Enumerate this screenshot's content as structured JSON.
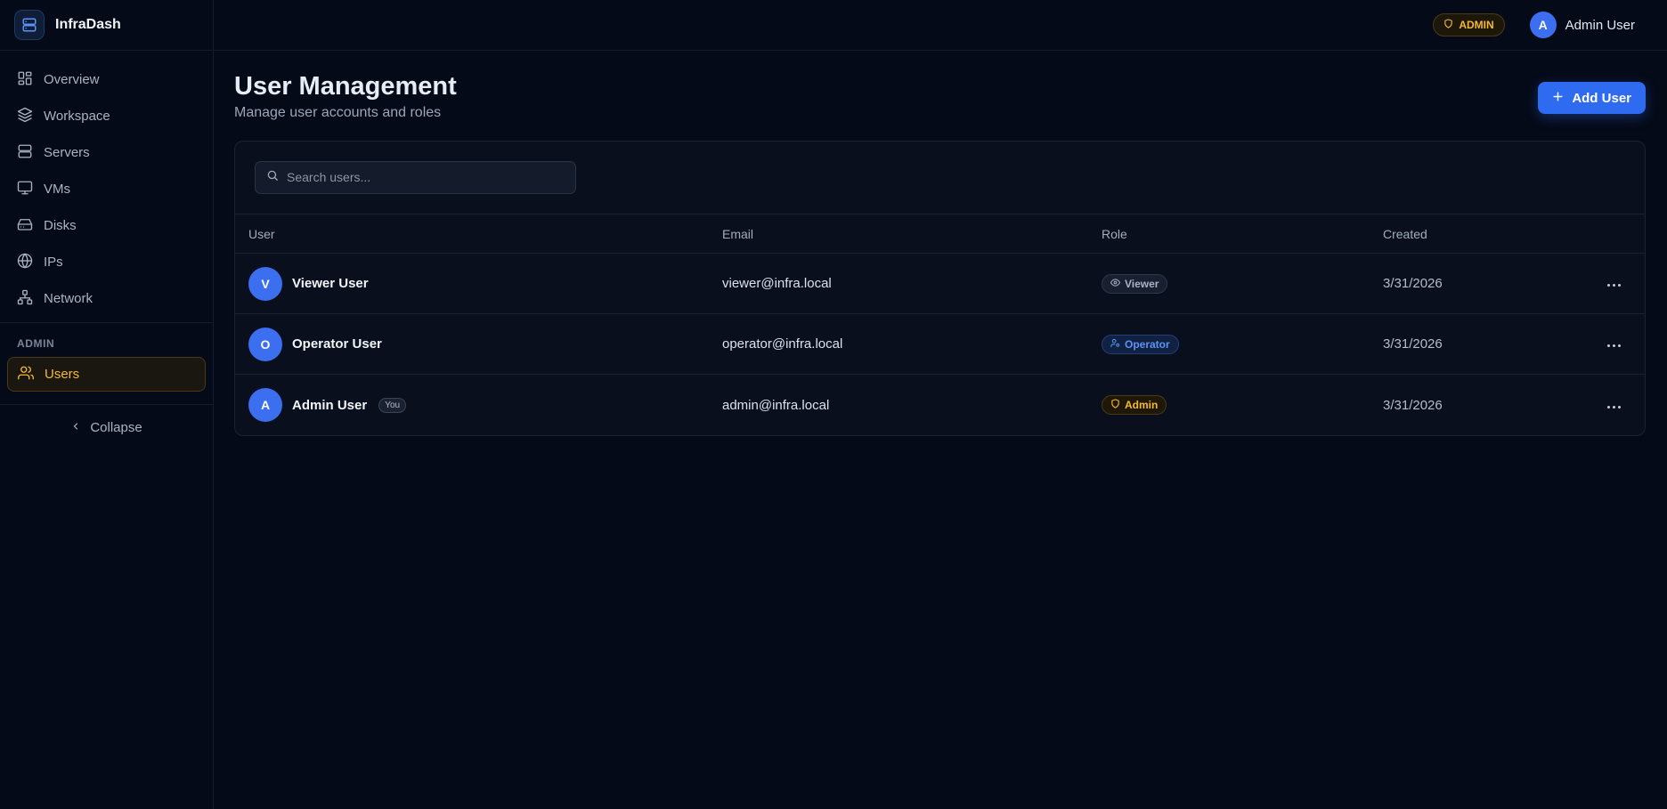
{
  "brand": {
    "name": "InfraDash"
  },
  "sidebar": {
    "items": [
      {
        "label": "Overview",
        "icon": "layout-dashboard-icon"
      },
      {
        "label": "Workspace",
        "icon": "layers-icon"
      },
      {
        "label": "Servers",
        "icon": "server-icon"
      },
      {
        "label": "VMs",
        "icon": "monitor-icon"
      },
      {
        "label": "Disks",
        "icon": "hard-drive-icon"
      },
      {
        "label": "IPs",
        "icon": "globe-icon"
      },
      {
        "label": "Network",
        "icon": "network-icon"
      }
    ],
    "admin_section_label": "ADMIN",
    "admin_items": [
      {
        "label": "Users",
        "icon": "users-icon",
        "active": true
      }
    ],
    "collapse_label": "Collapse"
  },
  "topbar": {
    "role_pill": "ADMIN",
    "user_initial": "A",
    "user_name": "Admin User"
  },
  "page": {
    "title": "User Management",
    "subtitle": "Manage user accounts and roles",
    "add_button_label": "Add User"
  },
  "search": {
    "placeholder": "Search users..."
  },
  "table": {
    "columns": [
      "User",
      "Email",
      "Role",
      "Created"
    ],
    "rows": [
      {
        "initial": "V",
        "name": "Viewer User",
        "you": "",
        "email": "viewer@infra.local",
        "role": "Viewer",
        "created": "3/31/2026"
      },
      {
        "initial": "O",
        "name": "Operator User",
        "you": "",
        "email": "operator@infra.local",
        "role": "Operator",
        "created": "3/31/2026"
      },
      {
        "initial": "A",
        "name": "Admin User",
        "you": "You",
        "email": "admin@infra.local",
        "role": "Admin",
        "created": "3/31/2026"
      }
    ]
  },
  "colors": {
    "accent": "#2f6bf0",
    "admin_amber": "#f5b935",
    "background": "#050a18"
  }
}
